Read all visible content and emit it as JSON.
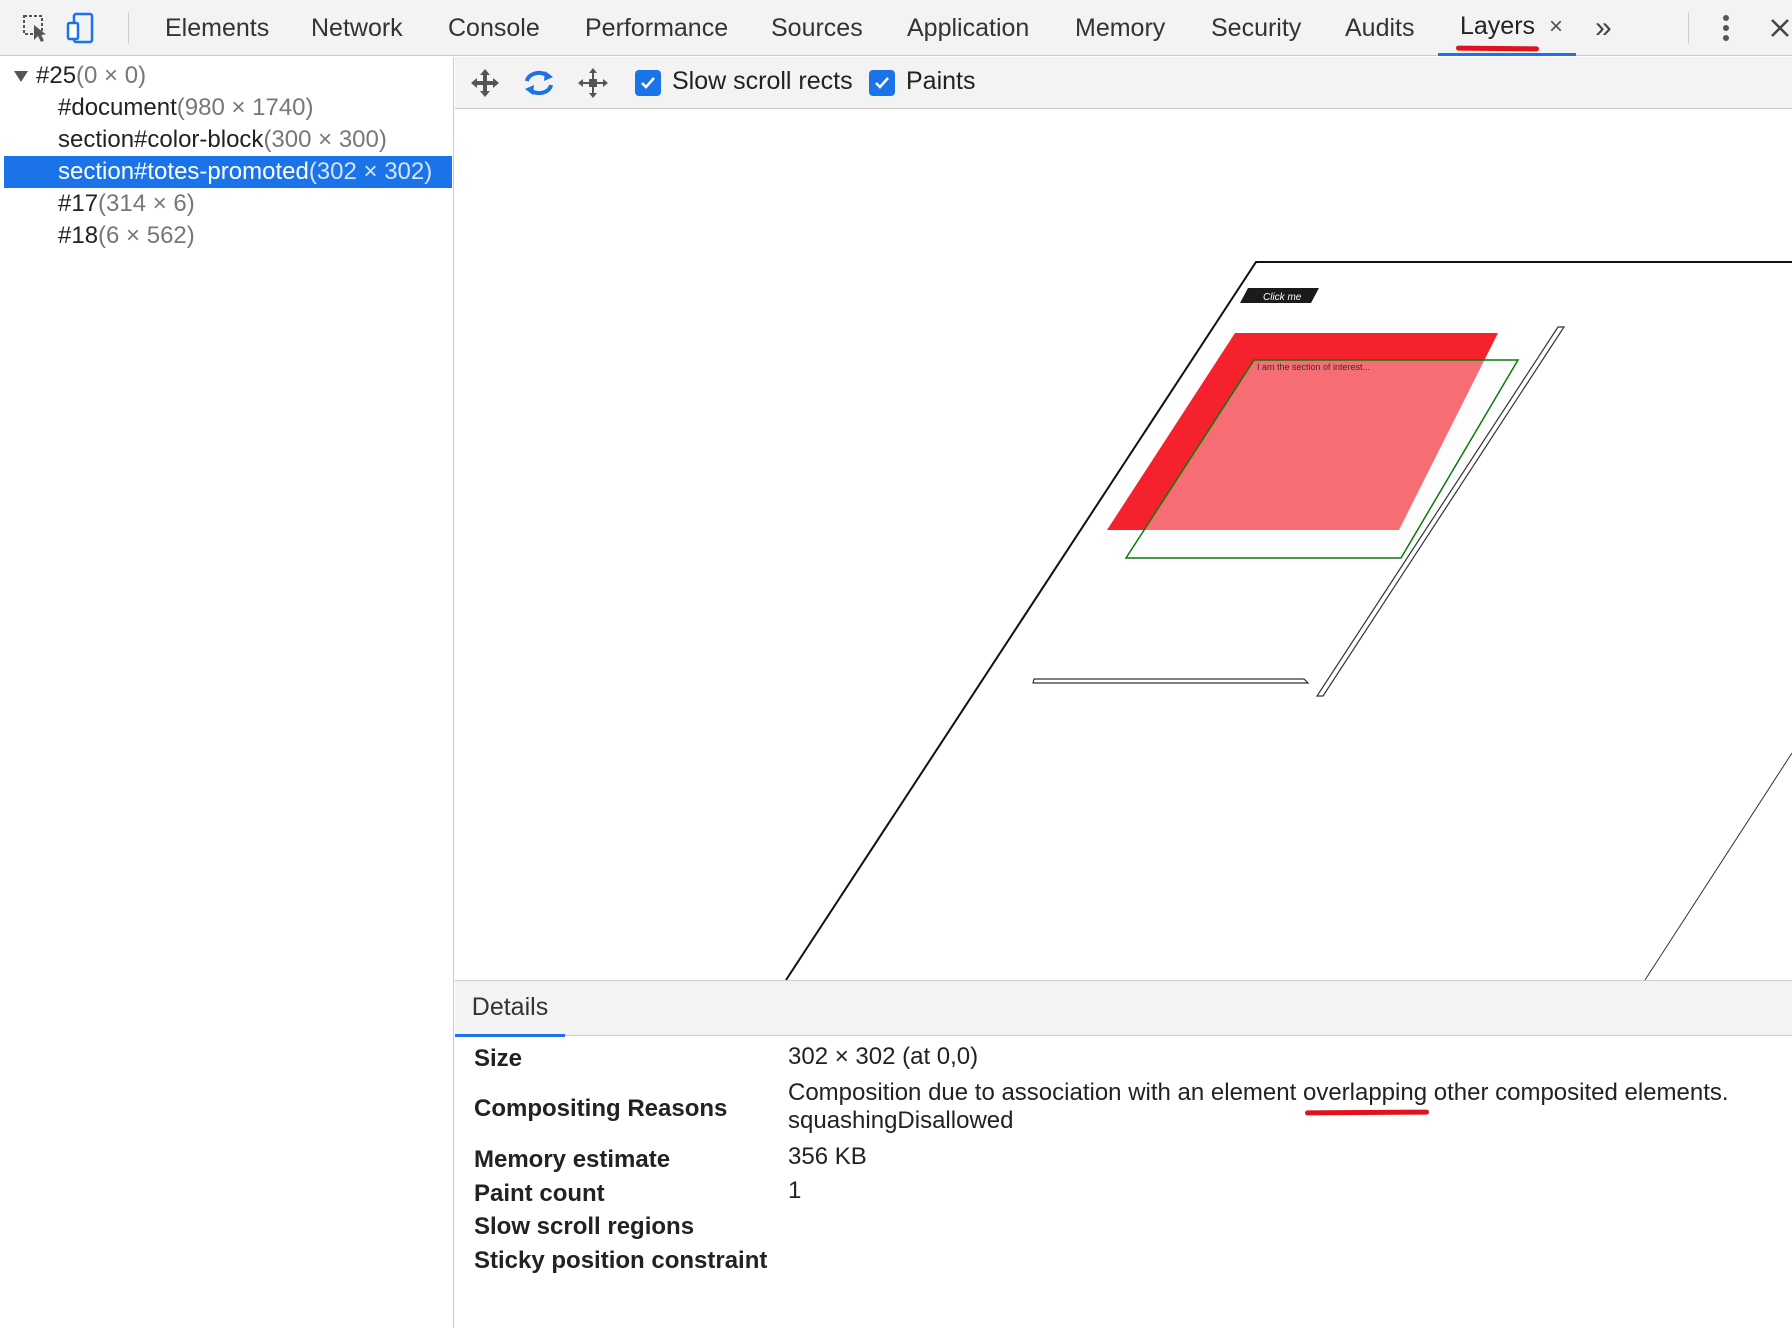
{
  "toolbar_top": {
    "icons": [
      "inspect-element-icon",
      "device-toolbar-icon",
      "more-tabs-icon",
      "kebab-menu-icon",
      "close-devtools-icon"
    ],
    "tabs": [
      {
        "label": "Elements"
      },
      {
        "label": "Network"
      },
      {
        "label": "Console"
      },
      {
        "label": "Performance"
      },
      {
        "label": "Sources"
      },
      {
        "label": "Application"
      },
      {
        "label": "Memory"
      },
      {
        "label": "Security"
      },
      {
        "label": "Audits"
      },
      {
        "label": "Layers",
        "active": true,
        "close": "×"
      }
    ],
    "overflow": "»",
    "kebab": "⋮",
    "close": "✕"
  },
  "layer_tree": {
    "rows": [
      {
        "name": "#25",
        "size": "(0 × 0)",
        "expanded": true
      },
      {
        "name": "#document",
        "size": "(980 × 1740)"
      },
      {
        "name": "section#color-block",
        "size": "(300 × 300)"
      },
      {
        "name": "section#totes-promoted",
        "size": "(302 × 302)",
        "selected": true
      },
      {
        "name": "#17",
        "size": "(314 × 6)"
      },
      {
        "name": "#18",
        "size": "(6 × 562)"
      }
    ]
  },
  "layers_toolbar": {
    "icons": [
      "pan-mode-icon",
      "rotate-mode-icon",
      "reset-transform-icon"
    ],
    "slow_scroll_label": "Slow scroll rects",
    "slow_scroll_checked": true,
    "paints_label": "Paints",
    "paints_checked": true
  },
  "viewport": {
    "button_text": "Click me",
    "section_text": "I am the section of interest...",
    "color_block": "#f5222d",
    "outline_color": "#0a7a0a"
  },
  "details": {
    "tab_label": "Details",
    "rows": [
      {
        "key": "Size",
        "value": "302 × 302 (at 0,0)"
      },
      {
        "key": "Compositing Reasons",
        "value_pre": "Composition due to association with an element ",
        "value_mark": "overlapping",
        "value_post": " other composited elements.",
        "value_line2": "squashingDisallowed"
      },
      {
        "key": "Memory estimate",
        "value": "356 KB"
      },
      {
        "key": "Paint count",
        "value": "1"
      },
      {
        "key": "Slow scroll regions",
        "value": ""
      },
      {
        "key": "Sticky position constraint",
        "value": ""
      }
    ]
  },
  "colors": {
    "accent": "#1a73e8",
    "annotation": "#e0121b"
  }
}
